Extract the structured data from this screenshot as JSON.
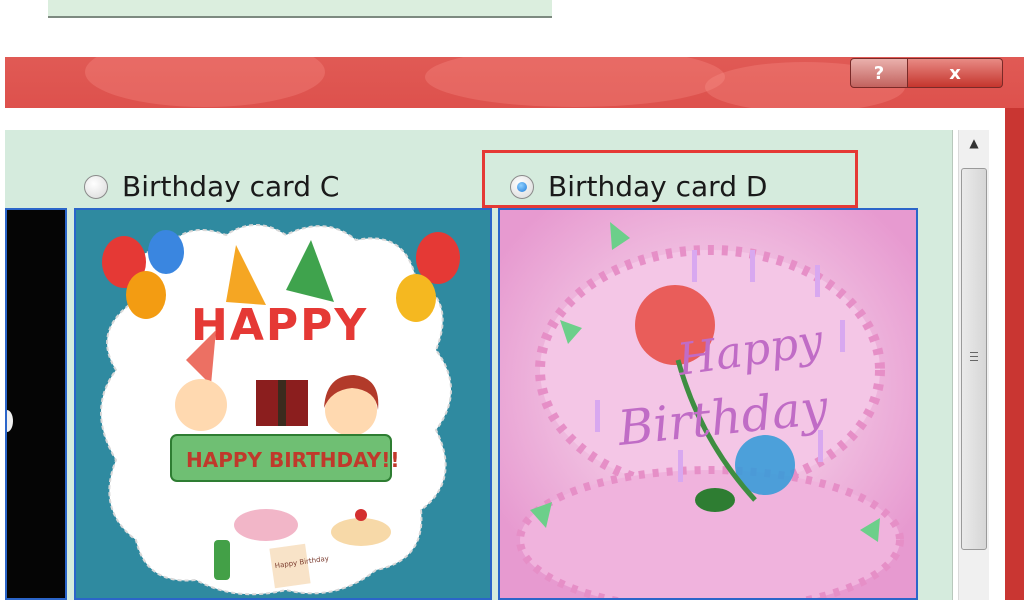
{
  "window": {
    "help_glyph": "?",
    "close_glyph": "x"
  },
  "options": [
    {
      "label": "Birthday card C",
      "selected": false
    },
    {
      "label": "Birthday card D",
      "selected": true
    }
  ],
  "cards": {
    "c": {
      "banner_top": "HAPPY",
      "banner_bottom": "HAPPY BIRTHDAY!!",
      "tag_text": "Happy Birthday"
    },
    "d": {
      "script_line1": "Happy",
      "script_line2": "Birthday"
    }
  },
  "scrollbar": {
    "up_glyph": "▲"
  },
  "colors": {
    "accent_highlight": "#e53935",
    "selection_border": "#2b65c9",
    "content_bg": "#d5ebdd"
  }
}
